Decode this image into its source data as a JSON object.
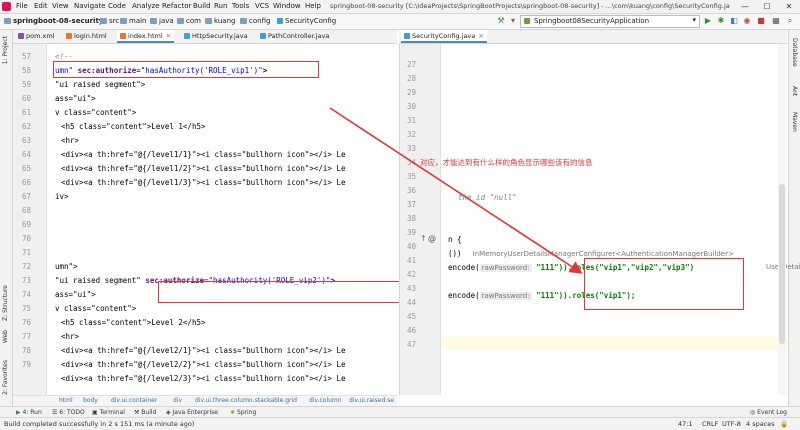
{
  "menubar": {
    "items": [
      "File",
      "Edit",
      "View",
      "Navigate",
      "Code",
      "Analyze",
      "Refactor",
      "Build",
      "Run",
      "Tools",
      "VCS",
      "Window",
      "Help"
    ],
    "window_title": "springboot-08-security [C:\\IdeaProjects\\SpringBootProjects\\springboot-08-security] - ...\\com\\kuang\\config\\SecurityConfig.java",
    "min_glyph": "—",
    "max_glyph": "☐",
    "close_glyph": "✕"
  },
  "navbar": {
    "project": "springboot-08-security",
    "crumbs": [
      "src",
      "main",
      "java",
      "com",
      "kuang",
      "config",
      "SecurityConfig"
    ],
    "run_config": "Springboot08SecurityApplication"
  },
  "left_strip": {
    "project_label": "1: Project",
    "structure_label": "Z: Structure",
    "web_label": "Web",
    "favorites_label": "2: Favorites"
  },
  "right_strip": {
    "database_label": "Database",
    "ant_label": "Ant",
    "maven_label": "Maven"
  },
  "tabs_left": [
    {
      "label": "pom.xml"
    },
    {
      "label": "login.html"
    },
    {
      "label": "index.html"
    },
    {
      "label": "HttpSecurity.java"
    },
    {
      "label": "PathController.java"
    }
  ],
  "tabs_right": [
    {
      "label": "SecurityConfig.java"
    }
  ],
  "left_editor": {
    "line_numbers": [
      "57",
      "58",
      "59",
      "60",
      "61",
      "62",
      "63",
      "64",
      "65",
      "66",
      "67",
      "68",
      "69",
      "70",
      "71",
      "72",
      "73",
      "74",
      "75",
      "76",
      "77",
      "78",
      "79"
    ],
    "lines": {
      "l57": "<!--",
      "l58_attr": "umn\"",
      "l58_ns": "sec:authorize",
      "l58_eq": "=",
      "l58_val": "\"hasAuthority('ROLE_vip1')\"",
      "l58_end": ">",
      "l59": "\"ui raised segment\">",
      "l60": "ass=\"ui\">",
      "l61": "v class=\"content\">",
      "l62": "<h5 class=\"content\">Level 1</h5>",
      "l63": "<hr>",
      "l64": "<div><a th:href=\"@{/level1/1}\"><i class=\"bullhorn icon\"></i> Le",
      "l65": "<div><a th:href=\"@{/level1/2}\"><i class=\"bullhorn icon\"></i> Le",
      "l66": "<div><a th:href=\"@{/level1/3}\"><i class=\"bullhorn icon\"></i> Le",
      "l67": "iv>",
      "l72": "umn\">",
      "l73_a": "\"ui raised segment\"",
      "l73_ns": "sec:authorize",
      "l73_eq": "=",
      "l73_val": "\"hasAuthority('ROLE_vip2')\"",
      "l73_end": ">",
      "l74": "ass=\"ui\">",
      "l75": "v class=\"content\">",
      "l76": "<h5 class=\"content\">Level 2</h5>",
      "l77": "<hr>",
      "l78": "<div><a th:href=\"@{/level2/1}\"><i class=\"bullhorn icon\"></i> Le",
      "l79": "<div><a th:href=\"@{/level2/2}\"><i class=\"bullhorn icon\"></i> Le",
      "l80": "<div><a th:href=\"@{/level2/3}\"><i class=\"bullhorn icon\"></i> Le"
    }
  },
  "right_editor": {
    "line_numbers": [
      "27",
      "28",
      "29",
      "30",
      "31",
      "32",
      "33",
      "34",
      "35",
      "36",
      "37",
      "38",
      "39",
      "40",
      "41",
      "42",
      "43",
      "44",
      "45",
      "46",
      "47"
    ],
    "lines": {
      "comment": "the id \"null\"",
      "l40": "n {",
      "l41_a": "())",
      "l41_hint": "InMemoryUserDetailsManagerConfigurer<AuthenticationManagerBuilder>",
      "l42_a": "encode(",
      "l42_hint": "rawPassword:",
      "l42_b": "\"111\")).roles(\"vip1\",\"vip2\",\"vip3\")",
      "l42_tail": "UserDetailsM",
      "l44_a": "encode(",
      "l44_hint": "rawPassword:",
      "l44_b": "\"111\")).roles(\"vip1\");"
    }
  },
  "annotation": {
    "text": "对应，才能达到有什么样的角色显示哪些该有的信息",
    "color": "#e53333"
  },
  "html_breadcrumbs": [
    "html",
    "body",
    "div.ui.container",
    "div",
    "div.ui.three.column.stackable.grid",
    "div.column",
    "div.ui.raised.se"
  ],
  "bottom_tools": [
    "4: Run",
    "6: TODO",
    "Terminal",
    "Build",
    "Java Enterprise",
    "Spring",
    "Event Log"
  ],
  "status": {
    "message": "Build completed successfully in 2 s 151 ms (a minute ago)",
    "position": "47:1",
    "line_sep": "CRLF",
    "encoding": "UTF-8",
    "indent": "4 spaces"
  },
  "colors": {
    "accent": "#4a88c7",
    "annotation_red": "#e53333"
  }
}
